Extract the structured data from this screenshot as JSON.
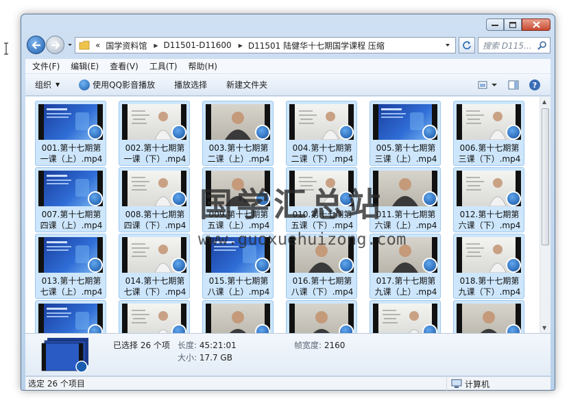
{
  "window": {
    "controls": {
      "minimize": "minimize-icon",
      "maximize": "maximize-icon",
      "close": "close-icon"
    }
  },
  "address": {
    "overflow_marker": "«",
    "segments": [
      "国学资料馆",
      "D11501-D11600",
      "D11501 陆健华十七期国学课程 压缩"
    ],
    "search_placeholder": "搜索 D115..."
  },
  "menu": [
    "文件(F)",
    "编辑(E)",
    "查看(V)",
    "工具(T)",
    "帮助(H)"
  ],
  "toolbar": {
    "organize": "组织",
    "play_qq": "使用QQ影音播放",
    "play_selection": "播放选择",
    "new_folder": "新建文件夹"
  },
  "files": [
    {
      "line1": "001.第十七期第",
      "line2": "一课（上）.mp4",
      "thumb": "slide"
    },
    {
      "line1": "002.第十七期第",
      "line2": "一课（下）.mp4",
      "thumb": "board"
    },
    {
      "line1": "003.第十七期第",
      "line2": "二课（上）.mp4",
      "thumb": "wall"
    },
    {
      "line1": "004.第十七期第",
      "line2": "二课（下）.mp4",
      "thumb": "board"
    },
    {
      "line1": "005.第十七期第",
      "line2": "三课（上）.mp4",
      "thumb": "slide"
    },
    {
      "line1": "006.第十七期第",
      "line2": "三课（下）.mp4",
      "thumb": "board"
    },
    {
      "line1": "007.第十七期第",
      "line2": "四课（上）.mp4",
      "thumb": "slide"
    },
    {
      "line1": "008.第十七期第",
      "line2": "四课（下）.mp4",
      "thumb": "board"
    },
    {
      "line1": "009.第十七期第",
      "line2": "五课（上）.mp4",
      "thumb": "wall"
    },
    {
      "line1": "010.第十七期第",
      "line2": "五课（下）.mp4",
      "thumb": "board"
    },
    {
      "line1": "011.第十七期第",
      "line2": "六课（上）.mp4",
      "thumb": "wall"
    },
    {
      "line1": "012.第十七期第",
      "line2": "六课（下）.mp4",
      "thumb": "board"
    },
    {
      "line1": "013.第十七期第",
      "line2": "七课（上）.mp4",
      "thumb": "slide"
    },
    {
      "line1": "014.第十七期第",
      "line2": "七课（下）.mp4",
      "thumb": "board"
    },
    {
      "line1": "015.第十七期第",
      "line2": "八课（上）.mp4",
      "thumb": "slide"
    },
    {
      "line1": "016.第十七期第",
      "line2": "八课（下）.mp4",
      "thumb": "wall"
    },
    {
      "line1": "017.第十七期第",
      "line2": "九课（上）.mp4",
      "thumb": "wall"
    },
    {
      "line1": "018.第十七期第",
      "line2": "九课（下）.mp4",
      "thumb": "board"
    },
    {
      "line1": "",
      "line2": "",
      "thumb": "slide"
    },
    {
      "line1": "",
      "line2": "",
      "thumb": "board"
    },
    {
      "line1": "",
      "line2": "",
      "thumb": "wall"
    },
    {
      "line1": "",
      "line2": "",
      "thumb": "wall"
    },
    {
      "line1": "",
      "line2": "",
      "thumb": "board"
    },
    {
      "line1": "",
      "line2": "",
      "thumb": "wall"
    }
  ],
  "watermark": {
    "title": "国学汇总站",
    "url": "www.guoxuehuizong.com"
  },
  "details": {
    "selected": "已选择 26 个项",
    "length_label": "长度:",
    "length_value": "45:21:01",
    "size_label": "大小:",
    "size_value": "17.7 GB",
    "framewidth_label": "帧宽度:",
    "framewidth_value": "2160"
  },
  "status": {
    "left": "选定 26 个项目",
    "right": "计算机"
  },
  "colors": {
    "selection": "#cde6fb",
    "accent": "#1f5fae"
  }
}
